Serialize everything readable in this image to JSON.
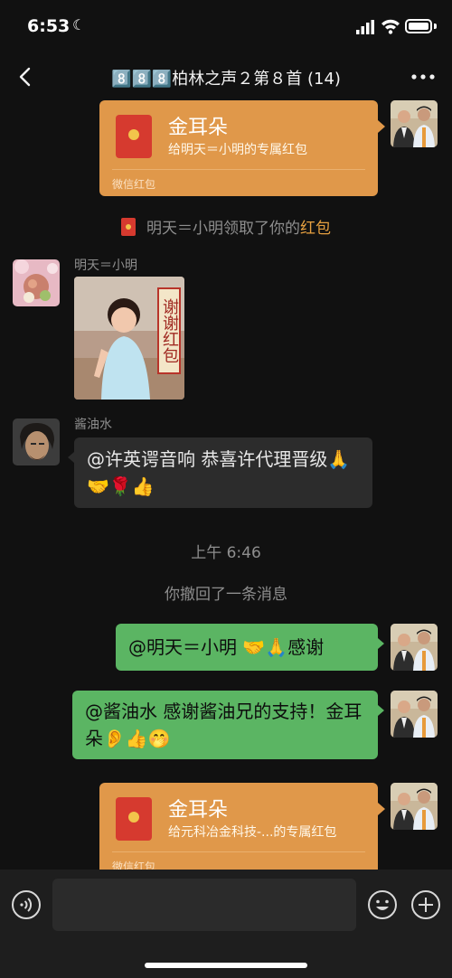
{
  "status": {
    "time": "6:53"
  },
  "header": {
    "title": "8️⃣8️⃣8️⃣柏林之声２第８首 (14)"
  },
  "messages": {
    "rp1": {
      "title": "金耳朵",
      "subtitle": "给明天＝小明的专属红包",
      "footer": "微信红包"
    },
    "sys_received": {
      "text": "明天＝小明领取了你的",
      "highlight": "红包"
    },
    "photo_msg": {
      "sender": "明天＝小明",
      "banner_text": "谢谢红包"
    },
    "soy_msg": {
      "sender": "酱油水",
      "text": "@许英谔音响 恭喜许代理晋级🙏🤝🌹👍"
    },
    "timestamp": "上午 6:46",
    "recall": "你撤回了一条消息",
    "green1": {
      "text": "@明天＝小明 🤝🙏感谢"
    },
    "green2": {
      "text": "@酱油水 感谢酱油兄的支持！金耳朵👂👍🤭"
    },
    "rp2": {
      "title": "金耳朵",
      "subtitle": "给元科冶金科技-...的专属红包",
      "footer": "微信红包"
    }
  },
  "colors": {
    "green_bubble": "#5bb563",
    "gray_bubble": "#2c2c2c",
    "red_packet": "#e0984a",
    "accent": "#e6a040"
  }
}
